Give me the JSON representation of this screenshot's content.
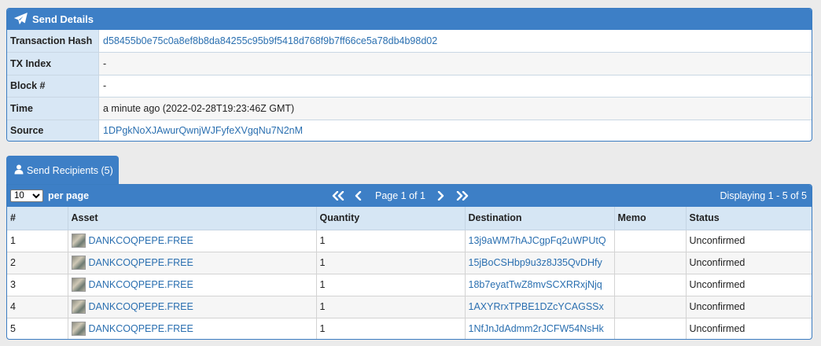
{
  "details": {
    "title": "Send Details",
    "rows": [
      {
        "key": "Transaction Hash",
        "value": "d58455b0e75c0a8ef8b8da84255c95b9f5418d768f9b7ff66ce5a78db4b98d02",
        "link": true
      },
      {
        "key": "TX Index",
        "value": "-",
        "link": false
      },
      {
        "key": "Block #",
        "value": "-",
        "link": false
      },
      {
        "key": "Time",
        "value": "a minute ago (2022-02-28T19:23:46Z GMT)",
        "link": false
      },
      {
        "key": "Source",
        "value": "1DPgkNoXJAwurQwnjWJFyfeXVgqNu7N2nM",
        "link": true
      }
    ]
  },
  "recipients": {
    "tab_label": "Send Recipients (5)",
    "per_page_value": "10",
    "per_page_label": "per page",
    "page_info": "Page 1 of 1",
    "displaying": "Displaying 1 - 5 of 5",
    "columns": [
      "#",
      "Asset",
      "Quantity",
      "Destination",
      "Memo",
      "Status"
    ],
    "rows": [
      {
        "num": "1",
        "asset": "DANKCOQPEPE.FREE",
        "quantity": "1",
        "destination": "13j9aWM7hAJCgpFq2uWPUtQ",
        "memo": "",
        "status": "Unconfirmed"
      },
      {
        "num": "2",
        "asset": "DANKCOQPEPE.FREE",
        "quantity": "1",
        "destination": "15jBoCSHbp9u3z8J35QvDHfy",
        "memo": "",
        "status": "Unconfirmed"
      },
      {
        "num": "3",
        "asset": "DANKCOQPEPE.FREE",
        "quantity": "1",
        "destination": "18b7eyatTwZ8mvSCXRRxjNjq",
        "memo": "",
        "status": "Unconfirmed"
      },
      {
        "num": "4",
        "asset": "DANKCOQPEPE.FREE",
        "quantity": "1",
        "destination": "1AXYRrxTPBE1DZcYCAGSSx",
        "memo": "",
        "status": "Unconfirmed"
      },
      {
        "num": "5",
        "asset": "DANKCOQPEPE.FREE",
        "quantity": "1",
        "destination": "1NfJnJdAdmm2rJCFW54NsHk",
        "memo": "",
        "status": "Unconfirmed"
      }
    ]
  }
}
